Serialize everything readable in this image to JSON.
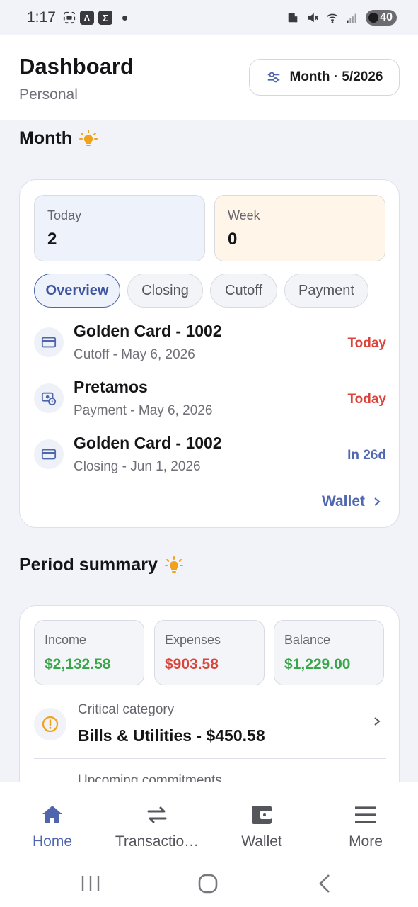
{
  "status_bar": {
    "time": "1:17",
    "battery": "40"
  },
  "header": {
    "title": "Dashboard",
    "subtitle": "Personal",
    "period_button": "Month · 5/2026"
  },
  "month_section": {
    "heading": "Month",
    "today_label": "Today",
    "today_value": "2",
    "week_label": "Week",
    "week_value": "0",
    "chips": [
      "Overview",
      "Closing",
      "Cutoff",
      "Payment"
    ],
    "active_chip": "Overview",
    "events": [
      {
        "title": "Golden Card - 1002",
        "subtitle": "Cutoff - May 6, 2026",
        "when": "Today",
        "icon": "credit-card-icon"
      },
      {
        "title": "Pretamos",
        "subtitle": "Payment - May 6, 2026",
        "when": "Today",
        "icon": "loan-clock-icon"
      },
      {
        "title": "Golden Card - 1002",
        "subtitle": "Closing - Jun 1, 2026",
        "when": "In 26d",
        "icon": "credit-card-icon"
      }
    ],
    "wallet_link": "Wallet"
  },
  "summary_section": {
    "heading": "Period summary",
    "income_label": "Income",
    "income_value": "$2,132.58",
    "expenses_label": "Expenses",
    "expenses_value": "$903.58",
    "balance_label": "Balance",
    "balance_value": "$1,229.00",
    "critical_label": "Critical category",
    "critical_value": "Bills & Utilities - $450.58",
    "upcoming_label": "Upcoming commitments"
  },
  "bottom_nav": [
    {
      "label": "Home",
      "icon": "home-icon"
    },
    {
      "label": "Transactio…",
      "icon": "transfer-arrows-icon"
    },
    {
      "label": "Wallet",
      "icon": "wallet-icon"
    },
    {
      "label": "More",
      "icon": "menu-icon"
    }
  ],
  "colors": {
    "accent": "#4f66ad",
    "positive": "#3aa64a",
    "negative": "#d9453c",
    "warning": "#f0a21b"
  }
}
